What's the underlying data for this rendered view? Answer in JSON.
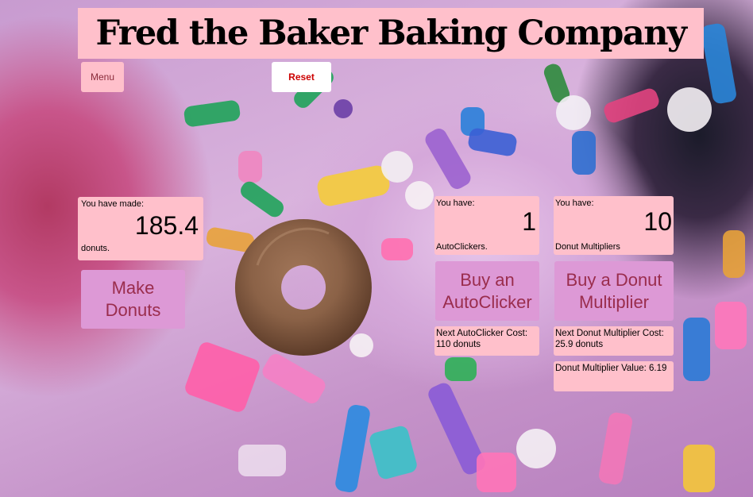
{
  "header": {
    "title": "Fred the Baker Baking Company"
  },
  "toolbar": {
    "menu_label": "Menu",
    "reset_label": "Reset"
  },
  "made": {
    "prefix": "You have made:",
    "value": "185.4",
    "suffix": "donuts."
  },
  "make_button": {
    "label": "Make Donuts"
  },
  "autoclickers": {
    "prefix": "You have:",
    "value": "1",
    "suffix": "AutoClickers."
  },
  "multipliers": {
    "prefix": "You have:",
    "value": "10",
    "suffix": "Donut Multipliers"
  },
  "buy_autoclicker": {
    "label": "Buy an AutoClicker"
  },
  "buy_multiplier": {
    "label": "Buy a Donut Multiplier"
  },
  "next_autoclicker_cost": {
    "text": "Next AutoClicker Cost: 110 donuts"
  },
  "next_multiplier_cost": {
    "text": "Next Donut Multiplier Cost: 25.9 donuts"
  },
  "multiplier_value": {
    "text": "Donut Multiplier Value: 6.19"
  },
  "donut_image": {
    "icon": "donut-icon"
  },
  "colors": {
    "panel": "#ffc0cb",
    "button": "#dd99d6",
    "button_text": "#9a2d4d",
    "reset_text": "#cc0000"
  }
}
